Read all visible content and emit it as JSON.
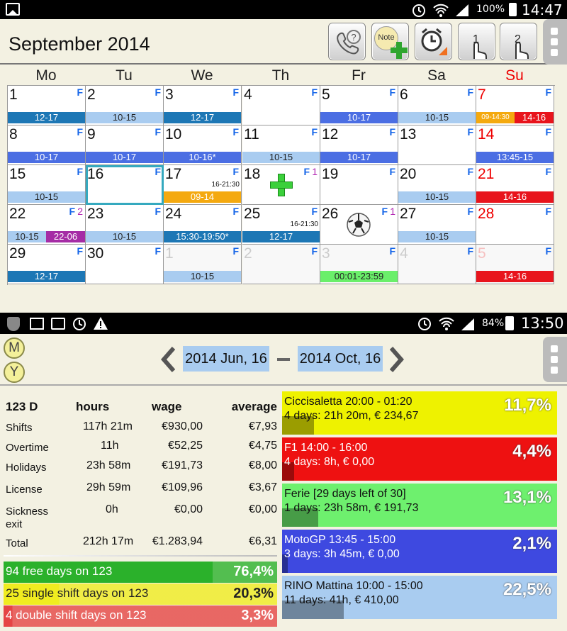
{
  "status_top": {
    "battery": "100%",
    "time": "14:47"
  },
  "status_bottom": {
    "battery": "84%",
    "time": "13:50"
  },
  "calendar": {
    "title": "September 2014",
    "buttons": {
      "note": "Note",
      "one": "1",
      "two": "2"
    },
    "weekdays": [
      "Mo",
      "Tu",
      "We",
      "Th",
      "Fr",
      "Sa",
      "Su"
    ],
    "flag": "F",
    "days": {
      "d1": "1",
      "d2": "2",
      "d3": "3",
      "d4": "4",
      "d5": "5",
      "d6": "6",
      "d7": "7",
      "d8": "8",
      "d9": "9",
      "d10": "10",
      "d11": "11",
      "d12": "12",
      "d13": "13",
      "d14": "14",
      "d15": "15",
      "d16": "16",
      "d17": "17",
      "d18": "18",
      "d19": "19",
      "d20": "20",
      "d21": "21",
      "d22": "22",
      "d23": "23",
      "d24": "24",
      "d25": "25",
      "d26": "26",
      "d27": "27",
      "d28": "28",
      "d29": "29",
      "d30": "30",
      "n1": "1",
      "n2": "2",
      "n3": "3",
      "n4": "4",
      "n5": "5"
    },
    "counts": {
      "c18": "1",
      "c22": "2",
      "c26": "1"
    },
    "small_times": {
      "t17": "16-21:30",
      "t25": "16-21:30"
    },
    "shifts": {
      "s1": "12-17",
      "s2": "10-15",
      "s3": "12-17",
      "s5": "10-17",
      "s6": "10-15",
      "s7a": "09-14:30",
      "s7b": "14-16",
      "s8": "10-17",
      "s9": "10-17",
      "s10": "10-16*",
      "s11": "10-15",
      "s12": "10-17",
      "s14": "13:45-15",
      "s15": "10-15",
      "s17": "09-14",
      "s20": "10-15",
      "s21": "14-16",
      "s22a": "10-15",
      "s22b": "22-06",
      "s23": "10-15",
      "s24": "15:30-19:50*",
      "s25": "12-17",
      "s27": "10-15",
      "s29": "12-17",
      "sn1": "10-15",
      "sn3": "00:01-23:59",
      "sn5": "14-16"
    }
  },
  "report": {
    "mode_m": "M",
    "mode_y": "Y",
    "date_from": "2014 Jun, 16",
    "date_to": "2014 Oct, 16",
    "headers": {
      "days": "123 D",
      "hours": "hours",
      "wage": "wage",
      "average": "average"
    },
    "rows": [
      {
        "label": "Shifts",
        "hours": "117h 21m",
        "wage": "€930,00",
        "average": "€7,93"
      },
      {
        "label": "Overtime",
        "hours": "11h",
        "wage": "€52,25",
        "average": "€4,75"
      },
      {
        "label": "Holidays",
        "hours": "23h 58m",
        "wage": "€191,73",
        "average": "€8,00"
      },
      {
        "label": "License",
        "hours": "29h 59m",
        "wage": "€109,96",
        "average": "€3,67"
      },
      {
        "label": "Sickness",
        "label2": "exit",
        "hours": "0h",
        "wage": "€0,00",
        "average": "€0,00"
      },
      {
        "label": "Total",
        "hours": "212h 17m",
        "wage": "€1.283,94",
        "average": "€6,31"
      }
    ],
    "bars": [
      {
        "label": "94 free days on 123",
        "pct": "76,4%",
        "value": 0.764,
        "color": "#2bb12b"
      },
      {
        "label": "25 single shift days on 123",
        "pct": "20,3%",
        "value": 0.203,
        "color": "#f0ec20"
      },
      {
        "label": "4 double shift days on 123",
        "pct": "3,3%",
        "value": 0.033,
        "color": "#e54545"
      }
    ],
    "shift_types": [
      {
        "line1": "Ciccisaletta 20:00 - 01:20",
        "line2": "4 days: 21h 20m, € 234,67",
        "pct": "11,7%",
        "value": 0.117,
        "color": "#eef200"
      },
      {
        "line1": "F1 14:00 - 16:00",
        "line2": "4 days: 8h, € 0,00",
        "pct": "4,4%",
        "value": 0.044,
        "color": "#ee1111"
      },
      {
        "line1": "Ferie [29 days left of 30]",
        "line2": "1 days: 23h 58m, € 191,73",
        "pct": "13,1%",
        "value": 0.131,
        "color": "#6ef06e"
      },
      {
        "line1": "MotoGP 13:45 - 15:00",
        "line2": "3 days: 3h 45m, € 0,00",
        "pct": "2,1%",
        "value": 0.021,
        "color": "#3e49e0"
      },
      {
        "line1": "RINO Mattina 10:00 - 15:00",
        "line2": "11 days: 41h, € 410,00",
        "pct": "22,5%",
        "value": 0.225,
        "color": "#a9ccf0"
      }
    ]
  }
}
